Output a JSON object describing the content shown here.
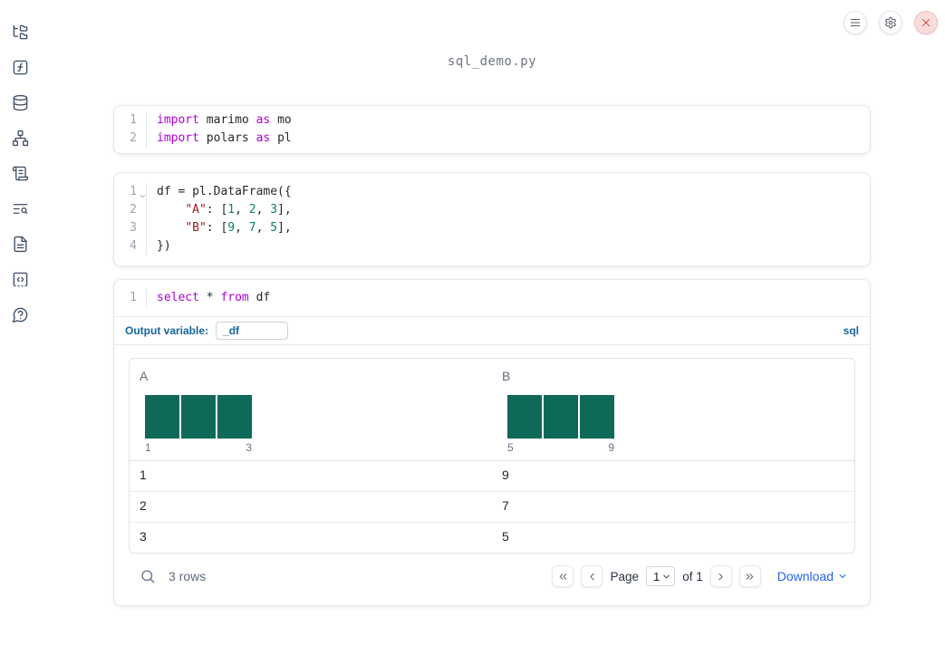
{
  "app": {
    "filename": "sql_demo.py"
  },
  "sidebar": {
    "icons": [
      "file-tree",
      "function-square",
      "database",
      "dependency-graph",
      "scroll-logs",
      "text-search",
      "document",
      "code-snippets",
      "help"
    ]
  },
  "topbar": {
    "buttons": [
      "menu",
      "settings",
      "close"
    ]
  },
  "colors": {
    "bar_teal": "#0e6958",
    "keyword": "#af00db",
    "string": "#a31515",
    "number": "#098658",
    "label_blue": "#14659c",
    "link_blue": "#2563eb"
  },
  "cell_imports": {
    "line_numbers": [
      "1",
      "2"
    ],
    "tokens": {
      "l1k1": "import",
      "l1p1": " marimo ",
      "l1k2": "as",
      "l1p2": " mo",
      "l2k1": "import",
      "l2p1": " polars ",
      "l2k2": "as",
      "l2p2": " pl"
    }
  },
  "cell_dataframe": {
    "line_numbers": [
      "1",
      "2",
      "3",
      "4"
    ],
    "tokens": {
      "l1": "df = pl.DataFrame({",
      "indent": "    ",
      "l2s": "\"A\"",
      "l2p1": ": [",
      "l2n1": "1",
      "l2c1": ", ",
      "l2n2": "2",
      "l2c2": ", ",
      "l2n3": "3",
      "l2p2": "],",
      "l3s": "\"B\"",
      "l3p1": ": [",
      "l3n1": "9",
      "l3c1": ", ",
      "l3n2": "7",
      "l3c2": ", ",
      "l3n3": "5",
      "l3p2": "],",
      "l4": "})"
    }
  },
  "cell_sql": {
    "line_numbers": [
      "1"
    ],
    "tokens": {
      "k1": "select",
      "p1": " * ",
      "k2": "from",
      "p2": " df"
    },
    "output_variable_label": "Output variable:",
    "output_variable_value": "_df",
    "language": "sql"
  },
  "table": {
    "columns": [
      {
        "name": "A",
        "hist_bars": [
          1,
          1,
          1
        ],
        "hist_min": "1",
        "hist_max": "3"
      },
      {
        "name": "B",
        "hist_bars": [
          1,
          1,
          1
        ],
        "hist_min": "5",
        "hist_max": "9"
      }
    ],
    "rows": [
      [
        "1",
        "9"
      ],
      [
        "2",
        "7"
      ],
      [
        "3",
        "5"
      ]
    ],
    "footer": {
      "row_count": "3 rows",
      "page_label": "Page",
      "page_value": "1",
      "of_label": "of 1",
      "download_label": "Download"
    }
  }
}
